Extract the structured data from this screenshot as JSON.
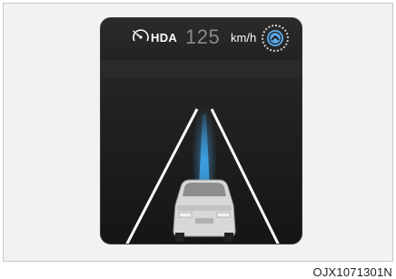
{
  "cluster": {
    "hda_label": "HDA",
    "speed_value": "125",
    "speed_unit": "km/h",
    "speedometer_icon": "speedometer-icon",
    "hda_button_icon": "chevron-up-icon"
  },
  "figure": {
    "credit_code": "OJX1071301N"
  },
  "colors": {
    "lane_guide": "#3a9ee0",
    "speed_dim": "#8a8a8a"
  }
}
